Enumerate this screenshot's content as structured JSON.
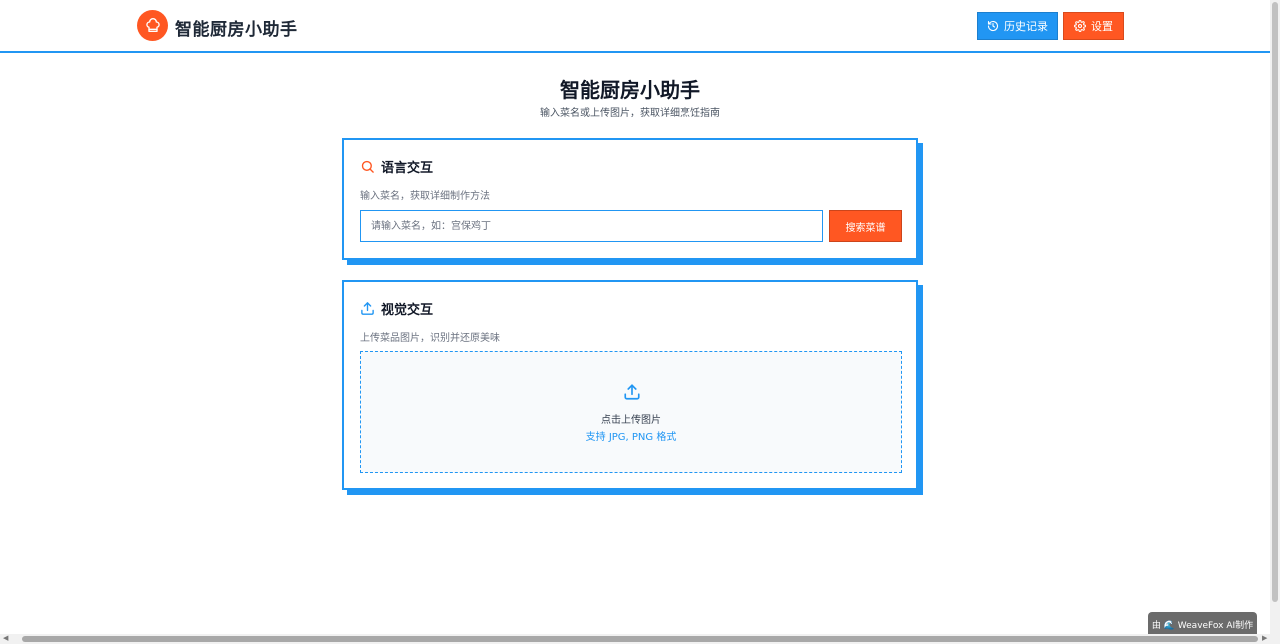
{
  "header": {
    "app_title": "智能厨房小助手",
    "history_label": "历史记录",
    "settings_label": "设置"
  },
  "hero": {
    "title": "智能厨房小助手",
    "subtitle": "输入菜名或上传图片，获取详细烹饪指南"
  },
  "voice_card": {
    "title": "语言交互",
    "description": "输入菜名，获取详细制作方法",
    "input_value": "",
    "input_placeholder": "请输入菜名，如：宫保鸡丁",
    "search_button": "搜索菜谱"
  },
  "visual_card": {
    "title": "视觉交互",
    "description": "上传菜品图片，识别并还原美味",
    "upload_label": "点击上传图片",
    "upload_hint": "支持 JPG, PNG 格式"
  },
  "badge": {
    "text": "由 🌊 WeaveFox AI制作"
  },
  "colors": {
    "primary": "#2196f3",
    "accent": "#ff5722"
  },
  "icons": {
    "logo": "chef-hat-icon",
    "history": "history-icon",
    "settings": "gear-icon",
    "search": "search-icon",
    "upload": "upload-icon"
  }
}
